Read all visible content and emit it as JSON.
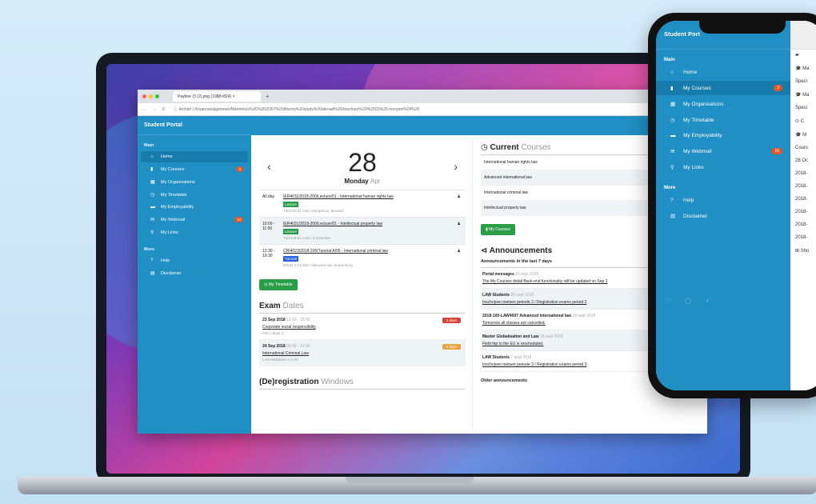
{
  "browser": {
    "tab_title": "Payboe (3 (2).png (1988×824) ×",
    "new_tab": "+",
    "nav": "← → C",
    "url": "ⓘ Archief | /h/uarese/algemeen/Marion/u/s%20%26/2357%20/theory%20study%20abroad%20/brochure%20%20(2)%20-revopen%24%20"
  },
  "sidebar": {
    "title": "Student Portal",
    "main_label": "Main",
    "more_label": "More",
    "items": [
      {
        "icon": "home-icon",
        "glyph": "⌂",
        "label": "Home"
      },
      {
        "icon": "book-icon",
        "glyph": "▮",
        "label": "My Courses",
        "badge": "2"
      },
      {
        "icon": "organisation-icon",
        "glyph": "▦",
        "label": "My Organisations"
      },
      {
        "icon": "clock-icon",
        "glyph": "◷",
        "label": "My Timetable"
      },
      {
        "icon": "briefcase-icon",
        "glyph": "▬",
        "label": "My Employability"
      },
      {
        "icon": "mail-icon",
        "glyph": "✉",
        "label": "My Webmail",
        "badge": "10"
      },
      {
        "icon": "link-icon",
        "glyph": "⚲",
        "label": "My Links"
      }
    ],
    "more_items": [
      {
        "icon": "help-icon",
        "glyph": "?",
        "label": "Help"
      },
      {
        "icon": "document-icon",
        "glyph": "▤",
        "label": "Disclaimer"
      }
    ]
  },
  "calendar": {
    "prev": "‹",
    "next": "›",
    "day_number": "28",
    "day_name": "Monday",
    "month": "Apr",
    "events": [
      {
        "time": "All day",
        "title": "IER4011/2018-200/Lecture/01 - International human rights law",
        "tag": "Lecture",
        "tag_color": "#2a9d48",
        "location": "T3/1440.01 Aula / Dergeloos, Bernard"
      },
      {
        "time": "10:00 - 11:00",
        "title": "IER4031/2018-200/Lecture/01 - Intellectual property law",
        "tag": "Lecture",
        "tag_color": "#2a9d48",
        "location": "T3/1440.01 Aula / S.Woerdes"
      },
      {
        "time": "13:30 - 19:30",
        "title": "CRI4023/2018-200/Tutorial A/05 - International criminal law",
        "tag": "Tutorial",
        "tag_color": "#2962d9",
        "location": "BOLD 3 C1.002 / laltcoven.van Noorenberg"
      }
    ],
    "timetable_button": "My Timetable"
  },
  "exams": {
    "title_bold": "Exam",
    "title_light": "Dates",
    "items": [
      {
        "date": "23 Sep 2018",
        "time": "13:00 - 15:00",
        "subject": "Corporate social responsibility",
        "room": "GBI Lokaal 3",
        "days": "3 days",
        "color": "#d9433c"
      },
      {
        "date": "24 Sep 2018",
        "time": "09:00 - 12:30",
        "subject": "International Criminal Law",
        "room": "LAW-WEBEXH A.2.30",
        "days": "5 days",
        "color": "#e8a33a"
      }
    ]
  },
  "deregistration": {
    "title_bold": "(De)registration",
    "title_light": "Windows"
  },
  "courses": {
    "title_bold": "Current",
    "title_light": "Courses",
    "items": [
      "International human rights law",
      "Advanced international law",
      "International criminal law",
      "Intellectual property law"
    ],
    "button": "My Courses"
  },
  "announcements": {
    "title": "Announcements",
    "subtitle": "Announcements in the last 7 days",
    "items": [
      {
        "who": "Portal messages",
        "when": "20 sept 2018",
        "msg": "The My Courses detail Back-end functionality will be updated on Sep 2"
      },
      {
        "who": "LAW Students",
        "when": "20 sept 2018",
        "msg": "Inschrijven toetsen periode 2 / Registration exams period 2"
      },
      {
        "who": "2018-100-LAW4007 Advanced International law",
        "when": "18 sept 2018",
        "msg": "Tomorrow all classes are cancelled."
      },
      {
        "who": "Master Globalisation and Law",
        "when": "18 sept 2018",
        "msg": "Field trip to the EU is rescheduled."
      },
      {
        "who": "LAW Students",
        "when": "7 sept 2018",
        "msg": "Inschrijven toetsen periode 3 / Registration exams period 3"
      }
    ],
    "older": "Older announcements"
  },
  "phone": {
    "title": "Student Port",
    "main_label": "Main",
    "more_label": "More",
    "footer_icons": "♡ ◯ ✓",
    "side_rows": [
      "▰",
      "🎓 Ma",
      "Speci",
      "🎓 Ma",
      "Speci",
      "⊙ C",
      "🎓 M",
      "Cours",
      "28 Oc",
      "2018-",
      "2018-",
      "2018-",
      "2018-",
      "2018-",
      "2018-",
      "⊞ Sho"
    ]
  }
}
